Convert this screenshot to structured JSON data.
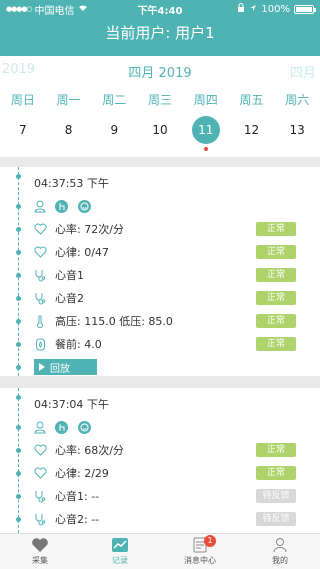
{
  "status": {
    "carrier": "中国电信",
    "time": "下午4:40",
    "battery": "100%"
  },
  "header": {
    "title": "当前用户: 用户1"
  },
  "calendar": {
    "prev_month": "2019",
    "month": "四月 2019",
    "next_month": "四月",
    "weekdays": [
      "周日",
      "周一",
      "周二",
      "周三",
      "周四",
      "周五",
      "周六"
    ],
    "dates": [
      "7",
      "8",
      "9",
      "10",
      "11",
      "12",
      "13"
    ],
    "selected": "11"
  },
  "records": [
    {
      "time": "04:37:53 下午",
      "rows": [
        {
          "text": "心率: 72次/分",
          "status": "正常"
        },
        {
          "text": "心律: 0/47",
          "status": "正常"
        },
        {
          "text": "心音1",
          "status": "正常"
        },
        {
          "text": "心音2",
          "status": "正常"
        },
        {
          "text": "高压: 115.0   低压: 85.0",
          "status": "正常"
        },
        {
          "text": "餐前: 4.0",
          "status": "正常"
        }
      ],
      "play": "回放"
    },
    {
      "time": "04:37:04 下午",
      "rows": [
        {
          "text": "心率: 68次/分",
          "status": "正常"
        },
        {
          "text": "心律: 2/29",
          "status": "正常"
        },
        {
          "text": "心音1: --",
          "status": "待反馈"
        },
        {
          "text": "心音2: --",
          "status": "待反馈"
        }
      ]
    }
  ],
  "tabs": [
    {
      "label": "采集",
      "icon": "heart-icon"
    },
    {
      "label": "记录",
      "icon": "chart-icon"
    },
    {
      "label": "消息中心",
      "icon": "message-icon",
      "badge": "1"
    },
    {
      "label": "我的",
      "icon": "user-icon"
    }
  ],
  "colors": {
    "accent": "#4fb3b4",
    "ok": "#aed36a",
    "pending": "#d8d8d8",
    "alert": "#e74c3c"
  }
}
